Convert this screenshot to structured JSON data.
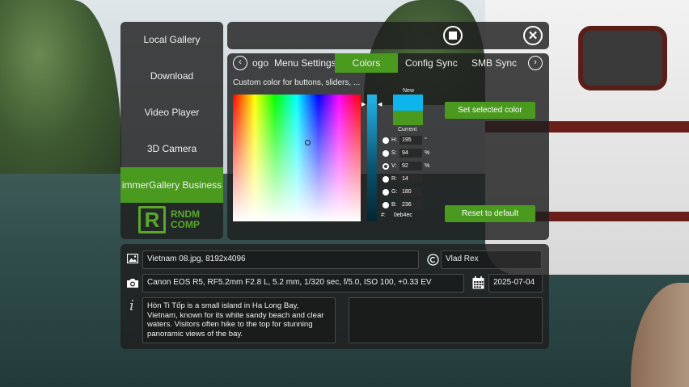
{
  "sidebar": {
    "items": [
      {
        "label": "Local Gallery"
      },
      {
        "label": "Download"
      },
      {
        "label": "Video Player"
      },
      {
        "label": "3D Camera"
      },
      {
        "label": "immerGallery Business",
        "active": true
      }
    ],
    "logo": {
      "letter": "R",
      "line1": "RNDM",
      "line2": "COMP"
    }
  },
  "tabs": {
    "items": [
      {
        "label": "ogo"
      },
      {
        "label": "Menu Settings"
      },
      {
        "label": "Colors",
        "active": true
      },
      {
        "label": "Config Sync"
      },
      {
        "label": "SMB Sync"
      }
    ],
    "prev_icon": "chevron-left-icon",
    "next_icon": "chevron-right-icon"
  },
  "colors": {
    "section_label": "Custom color for buttons, sliders, ...",
    "new_label": "New",
    "current_label": "Current",
    "new_color": "#0eb4ec",
    "current_color": "#4a9a1f",
    "fields": [
      {
        "key": "H:",
        "value": "195",
        "unit": "°",
        "selected": false
      },
      {
        "key": "S:",
        "value": "94",
        "unit": "%",
        "selected": false
      },
      {
        "key": "V:",
        "value": "92",
        "unit": "%",
        "selected": true
      },
      {
        "key": "R:",
        "value": "14",
        "unit": "",
        "selected": false
      },
      {
        "key": "G:",
        "value": "180",
        "unit": "",
        "selected": false
      },
      {
        "key": "B:",
        "value": "236",
        "unit": "",
        "selected": false
      }
    ],
    "hex_label": "#:",
    "hex_value": "0eb4ec",
    "set_button": "Set selected color",
    "reset_button": "Reset to default"
  },
  "info": {
    "file": "Vietnam 08.jpg, 8192x4096",
    "author": "Vlad Rex",
    "camera": "Canon EOS R5, RF5.2mm F2.8 L, 5.2 mm, 1/320 sec, f/5.0, ISO 100, +0.33 EV",
    "date": "2025-07-04",
    "description": "Hòn Ti Tốp is a small island in Ha Long Bay, Vietnam, known for its white sandy beach and clear waters. Visitors often hike to the top for stunning panoramic views of the bay."
  },
  "theme": {
    "accent": "#4a9a1f"
  }
}
